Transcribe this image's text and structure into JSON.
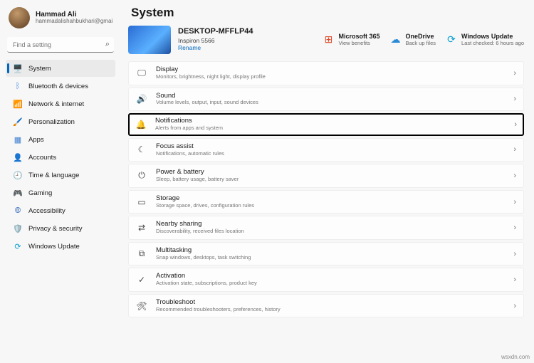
{
  "profile": {
    "name": "Hammad Ali",
    "email": "hammadalishahbukhari@gmail.com"
  },
  "search": {
    "placeholder": "Find a setting"
  },
  "nav": [
    {
      "label": "System",
      "icon": "🖥️",
      "color": "#0067c0",
      "active": true
    },
    {
      "label": "Bluetooth & devices",
      "icon": "ᛒ",
      "color": "#4a8de0"
    },
    {
      "label": "Network & internet",
      "icon": "📶",
      "color": "#5aa0e0"
    },
    {
      "label": "Personalization",
      "icon": "🖌️",
      "color": "#d06a3a"
    },
    {
      "label": "Apps",
      "icon": "▦",
      "color": "#3a7dd0"
    },
    {
      "label": "Accounts",
      "icon": "👤",
      "color": "#5a8a6a"
    },
    {
      "label": "Time & language",
      "icon": "🕘",
      "color": "#666"
    },
    {
      "label": "Gaming",
      "icon": "🎮",
      "color": "#666"
    },
    {
      "label": "Accessibility",
      "icon": "⦾",
      "color": "#4a7ac0"
    },
    {
      "label": "Privacy & security",
      "icon": "🛡️",
      "color": "#666"
    },
    {
      "label": "Windows Update",
      "icon": "⟳",
      "color": "#0aa0d0"
    }
  ],
  "page_title": "System",
  "pc": {
    "name": "DESKTOP-MFFLP44",
    "model": "Inspiron 5566",
    "rename": "Rename"
  },
  "cloud": [
    {
      "title": "Microsoft 365",
      "sub": "View benefits",
      "icon": "⊞",
      "color": "#e04a2a"
    },
    {
      "title": "OneDrive",
      "sub": "Back up files",
      "icon": "☁",
      "color": "#2a8ad6"
    },
    {
      "title": "Windows Update",
      "sub": "Last checked: 6 hours ago",
      "icon": "⟳",
      "color": "#0aa0d0"
    }
  ],
  "rows": [
    {
      "title": "Display",
      "sub": "Monitors, brightness, night light, display profile",
      "icon": "🖵"
    },
    {
      "title": "Sound",
      "sub": "Volume levels, output, input, sound devices",
      "icon": "🔊"
    },
    {
      "title": "Notifications",
      "sub": "Alerts from apps and system",
      "icon": "🔔",
      "highlight": true
    },
    {
      "title": "Focus assist",
      "sub": "Notifications, automatic rules",
      "icon": "☾"
    },
    {
      "title": "Power & battery",
      "sub": "Sleep, battery usage, battery saver",
      "icon": "⏻"
    },
    {
      "title": "Storage",
      "sub": "Storage space, drives, configuration rules",
      "icon": "▭"
    },
    {
      "title": "Nearby sharing",
      "sub": "Discoverability, received files location",
      "icon": "⇄"
    },
    {
      "title": "Multitasking",
      "sub": "Snap windows, desktops, task switching",
      "icon": "⧉"
    },
    {
      "title": "Activation",
      "sub": "Activation state, subscriptions, product key",
      "icon": "✓"
    },
    {
      "title": "Troubleshoot",
      "sub": "Recommended troubleshooters, preferences, history",
      "icon": "🛠"
    }
  ],
  "watermark": "wsxdn.com"
}
